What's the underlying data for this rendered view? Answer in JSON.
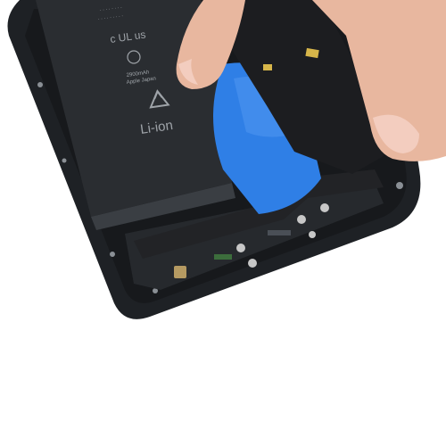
{
  "battery": {
    "chemistry_label": "Li-ion",
    "capacity_label": "2900mAh",
    "assembled_label": "Apple Japan",
    "cert_label": "c UL us"
  },
  "colors": {
    "background": "#ffffff",
    "housing": "#1e2125",
    "battery": "#2a2d31",
    "pry_tool": "#2f7fe6",
    "flex_cable": "#222326",
    "finger": "#e8b79f"
  }
}
